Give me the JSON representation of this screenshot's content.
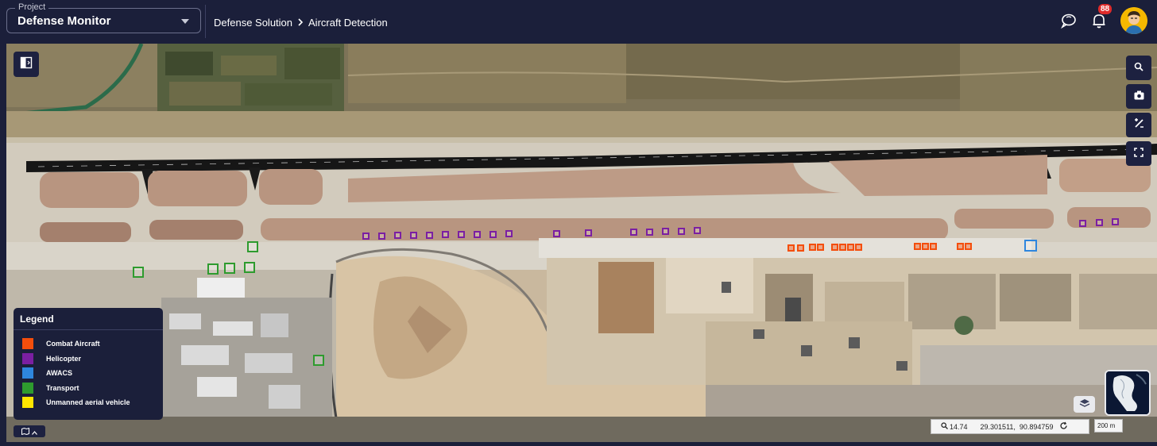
{
  "header": {
    "project_caption": "Project",
    "project_value": "Defense Monitor",
    "breadcrumb": [
      "Defense Solution",
      "Aircraft Detection"
    ],
    "notification_count": "88"
  },
  "icons": {
    "left_panel_toggle": "panel-toggle-icon",
    "chat": "chat-icon",
    "bell": "bell-icon",
    "avatar": "avatar",
    "tools": [
      "search-icon",
      "camera-icon",
      "measure-icon",
      "fullscreen-icon"
    ],
    "basemap": "layers-icon"
  },
  "legend": {
    "title": "Legend",
    "items": [
      {
        "label": "Combat Aircraft",
        "color": "#f44e0c"
      },
      {
        "label": "Helicopter",
        "color": "#7b1fa2"
      },
      {
        "label": "AWACS",
        "color": "#2e86de"
      },
      {
        "label": "Transport",
        "color": "#2e9b2e"
      },
      {
        "label": "Unmanned aerial vehicle",
        "color": "#ffe600"
      }
    ]
  },
  "status": {
    "zoom": "14.74",
    "coordinates": "29.301511,  90.894759",
    "scale": "200 m"
  }
}
